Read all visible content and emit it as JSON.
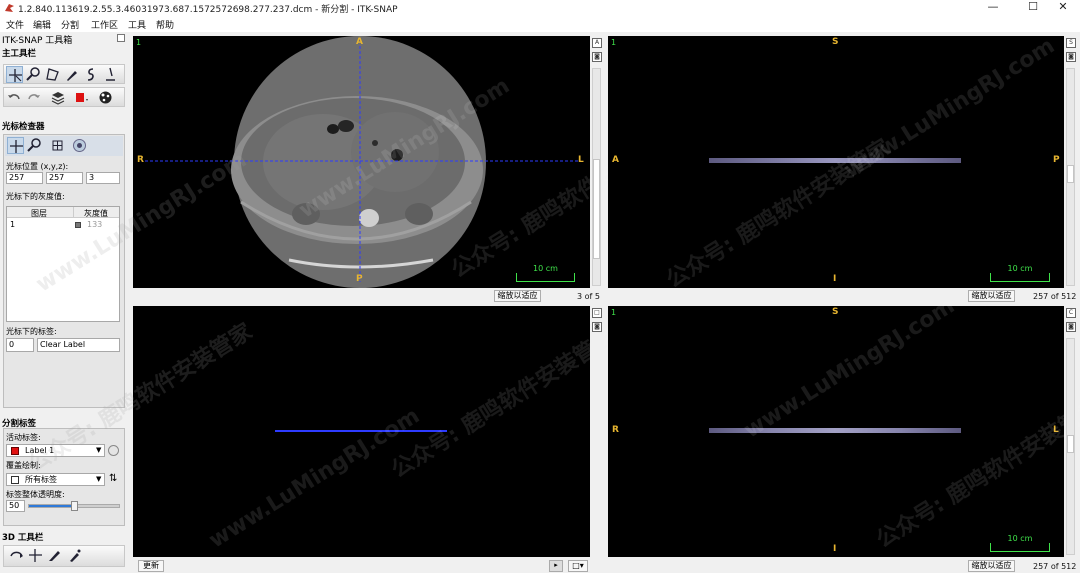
{
  "window": {
    "title": "1.2.840.113619.2.55.3.46031973.687.1572572698.277.237.dcm - 新分割 - ITK-SNAP",
    "controls": {
      "minimize": "—",
      "maximize": "☐",
      "close": "✕"
    }
  },
  "menu": [
    "文件",
    "编辑",
    "分割",
    "工作区",
    "工具",
    "帮助"
  ],
  "toolbox": {
    "title": "ITK-SNAP 工具箱",
    "main_toolbar_label": "主工具栏",
    "cursor_inspector_label": "光标检查器",
    "cursor_position_label": "光标位置 (x,y,z):",
    "cursor_position": [
      "257",
      "257",
      "3"
    ],
    "intensity_label": "光标下的灰度值:",
    "intensity_table": {
      "headers": [
        "图层",
        "灰度值"
      ],
      "rows": [
        {
          "layer": "1",
          "value": "133"
        }
      ]
    },
    "label_under_cursor_label": "光标下的标签:",
    "label_under_cursor_id": "0",
    "label_under_cursor_name": "Clear Label",
    "segmentation_labels_label": "分割标签",
    "active_label_label": "活动标签:",
    "active_label": "Label 1",
    "active_label_color": "#e01010",
    "paint_over_label": "覆盖绘制:",
    "paint_over": "所有标签",
    "opacity_label": "标签整体透明度:",
    "opacity_value": "50",
    "opacity_fraction": 0.5,
    "toolbar_3d_label": "3D 工具栏"
  },
  "views": {
    "axial": {
      "number": "1",
      "top": "A",
      "bottom": "P",
      "left": "R",
      "right": "L",
      "scale": "10 cm",
      "fit_button": "缩放以适应",
      "slice": "3 of 5"
    },
    "sagittal": {
      "number": "1",
      "top": "S",
      "bottom": "I",
      "left": "A",
      "right": "P",
      "scale": "10 cm",
      "fit_button": "缩放以适应",
      "slice": "257 of 512"
    },
    "render3d": {
      "update_button": "更新"
    },
    "coronal": {
      "number": "1",
      "top": "S",
      "bottom": "I",
      "left": "R",
      "right": "L",
      "scale": "10 cm",
      "fit_button": "缩放以适应",
      "slice": "257 of 512"
    }
  },
  "watermark": [
    "www.LuMingRJ.com",
    "公众号: 鹿鸣软件安装管家"
  ]
}
